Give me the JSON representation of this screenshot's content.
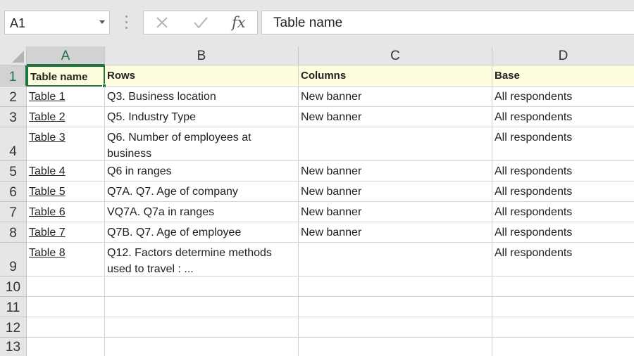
{
  "formula_bar": {
    "name_box": "A1",
    "cancel_icon": "x-icon",
    "enter_icon": "check-icon",
    "fx_label": "fx",
    "formula_value": "Table name"
  },
  "columns": [
    "A",
    "B",
    "C",
    "D"
  ],
  "row_numbers": [
    "1",
    "2",
    "3",
    "4",
    "5",
    "6",
    "7",
    "8",
    "9",
    "10",
    "11",
    "12",
    "13"
  ],
  "accent_color": "#217346",
  "header_row": {
    "a": "Table name",
    "b": "Rows",
    "c": "Columns",
    "d": "Base"
  },
  "rows": [
    {
      "a": "Table 1",
      "b": "Q3. Business location",
      "c": "New banner",
      "d": "All respondents"
    },
    {
      "a": "Table 2",
      "b": "Q5. Industry Type",
      "c": "New banner",
      "d": "All respondents"
    },
    {
      "a": "Table 3",
      "b": "Q6. Number of employees at business",
      "c": "",
      "d": "All respondents"
    },
    {
      "a": "Table 4",
      "b": "Q6 in ranges",
      "c": "New banner",
      "d": "All respondents"
    },
    {
      "a": "Table 5",
      "b": "Q7A. Q7. Age of company",
      "c": "New banner",
      "d": "All respondents"
    },
    {
      "a": "Table 6",
      "b": "VQ7A. Q7a in ranges",
      "c": "New banner",
      "d": "All respondents"
    },
    {
      "a": "Table 7",
      "b": "Q7B. Q7. Age of employee",
      "c": "New banner",
      "d": "All respondents"
    },
    {
      "a": "Table 8",
      "b": "Q12. Factors determine methods used to travel : ...",
      "c": "",
      "d": "All respondents"
    }
  ]
}
